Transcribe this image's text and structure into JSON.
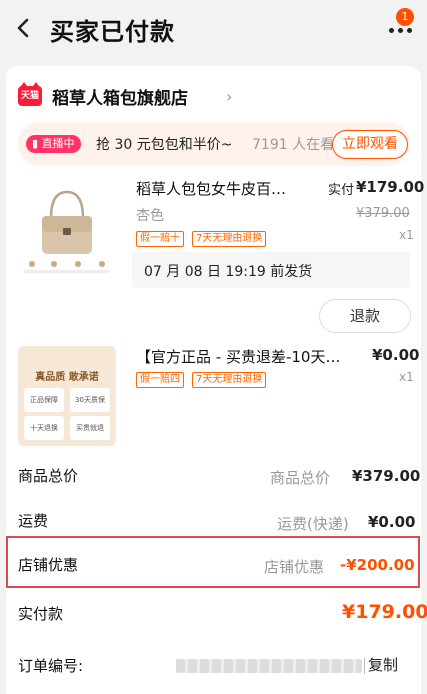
{
  "header": {
    "title": "买家已付款",
    "badge_count": "1"
  },
  "store": {
    "logo_text": "天猫",
    "name": "稻草人箱包旗舰店"
  },
  "live": {
    "badge": "直播中",
    "text": "抢 30 元包包和半价~",
    "viewers": "7191 人在看",
    "watch_button": "立即观看"
  },
  "products": [
    {
      "title": "稻草人包包女牛皮百…",
      "variant": "杏色",
      "tags": [
        "假一赔十",
        "7天无理由退换"
      ],
      "price_label": "实付",
      "price": "¥179.00",
      "original_price": "¥379.00",
      "quantity": "x1",
      "shipping_note": "07 月 08 日 19:19 前发货",
      "refund_button": "退款"
    },
    {
      "title": "【官方正品 - 买贵退差-10天…",
      "tags": [
        "假一赔四",
        "7天无理由退换"
      ],
      "price": "¥0.00",
      "quantity": "x1",
      "image_texts": [
        "真品质 敢承诺",
        "正品保障",
        "30天质保",
        "十天退换",
        "买贵就退"
      ]
    }
  ],
  "summary": {
    "goods_total": {
      "label": "商品总价",
      "key": "商品总价",
      "value": "¥379.00"
    },
    "shipping": {
      "label": "运费",
      "key": "运费(快递)",
      "value": "¥0.00"
    },
    "store_discount": {
      "label": "店铺优惠",
      "key": "店铺优惠",
      "value": "-¥200.00"
    },
    "paid": {
      "label": "实付款",
      "value": "¥179.00"
    },
    "order": {
      "label": "订单编号:",
      "copy_button": "复制"
    }
  },
  "colors": {
    "accent": "#ff5000",
    "tmall_red": "#ff1a3a",
    "highlight_border": "#e04a4a"
  }
}
